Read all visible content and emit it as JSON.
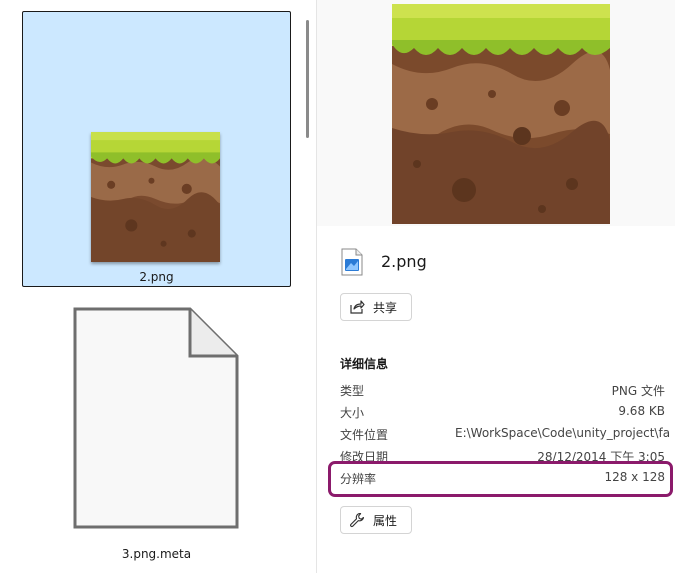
{
  "files": {
    "selected": {
      "name": "2.png"
    },
    "other": {
      "name": "3.png.meta"
    }
  },
  "details": {
    "title": "2.png",
    "share_label": "共享",
    "section_heading": "详细信息",
    "properties_label": "属性",
    "rows": [
      {
        "key": "类型",
        "value": "PNG 文件"
      },
      {
        "key": "大小",
        "value": "9.68 KB"
      },
      {
        "key": "文件位置",
        "value": "E:\\WorkSpace\\Code\\unity_project\\far..."
      },
      {
        "key": "修改日期",
        "value": "28/12/2014 下午 3:05"
      },
      {
        "key": "分辨率",
        "value": "128 x 128"
      }
    ]
  },
  "colors": {
    "selection_bg": "#cce8ff",
    "highlight_border": "#8b1a6b",
    "grass": "#a8cf2e",
    "dirt": "#8a5a3a"
  },
  "icons": {
    "share": "share-icon",
    "properties": "wrench-icon",
    "file": "image-file-icon",
    "document": "document-icon"
  }
}
